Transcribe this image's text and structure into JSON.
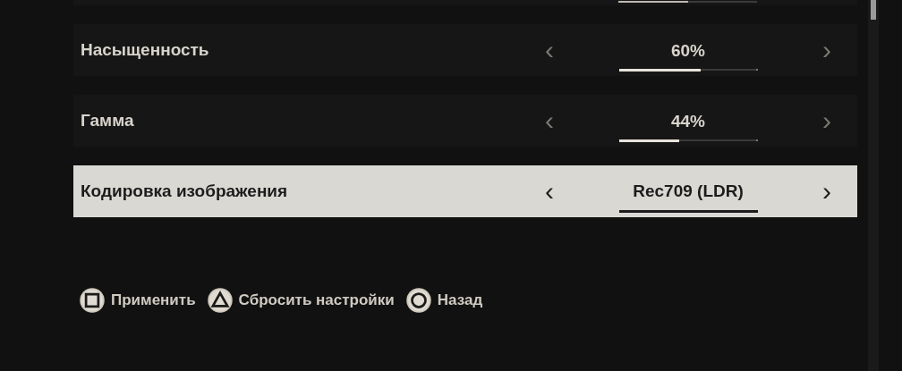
{
  "top_row": {
    "level": 0.5
  },
  "rows": [
    {
      "kind": "slider",
      "label": "Насыщенность",
      "value": "60%",
      "level": 0.6,
      "selected": false
    },
    {
      "kind": "slider",
      "label": "Гамма",
      "value": "44%",
      "level": 0.44,
      "selected": false
    },
    {
      "kind": "choice",
      "label": "Кодировка изображения",
      "value": "Rec709 (LDR)",
      "selected": true
    }
  ],
  "prev_glyph": "‹",
  "next_glyph": "›",
  "footer": [
    {
      "kind": "square",
      "label": "Применить"
    },
    {
      "kind": "triangle",
      "label": "Сбросить настройки"
    },
    {
      "kind": "circle",
      "label": "Назад"
    }
  ]
}
